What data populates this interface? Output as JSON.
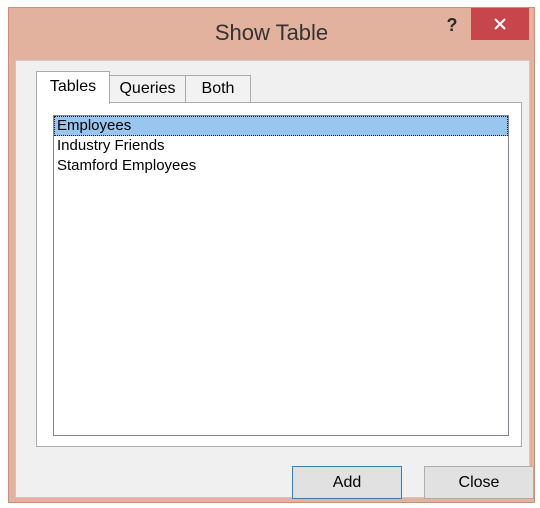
{
  "window": {
    "title": "Show Table",
    "help_label": "?"
  },
  "tabs": [
    {
      "label": "Tables",
      "active": true
    },
    {
      "label": "Queries",
      "active": false
    },
    {
      "label": "Both",
      "active": false
    }
  ],
  "list": {
    "items": [
      {
        "label": "Employees",
        "selected": true
      },
      {
        "label": "Industry Friends",
        "selected": false
      },
      {
        "label": "Stamford Employees",
        "selected": false
      }
    ]
  },
  "buttons": {
    "add_label": "Add",
    "close_label": "Close"
  },
  "colors": {
    "titlebar": "#e2b29e",
    "close_button": "#c8454b",
    "selection": "#99c6ee",
    "default_button_border": "#3c7fb1"
  }
}
